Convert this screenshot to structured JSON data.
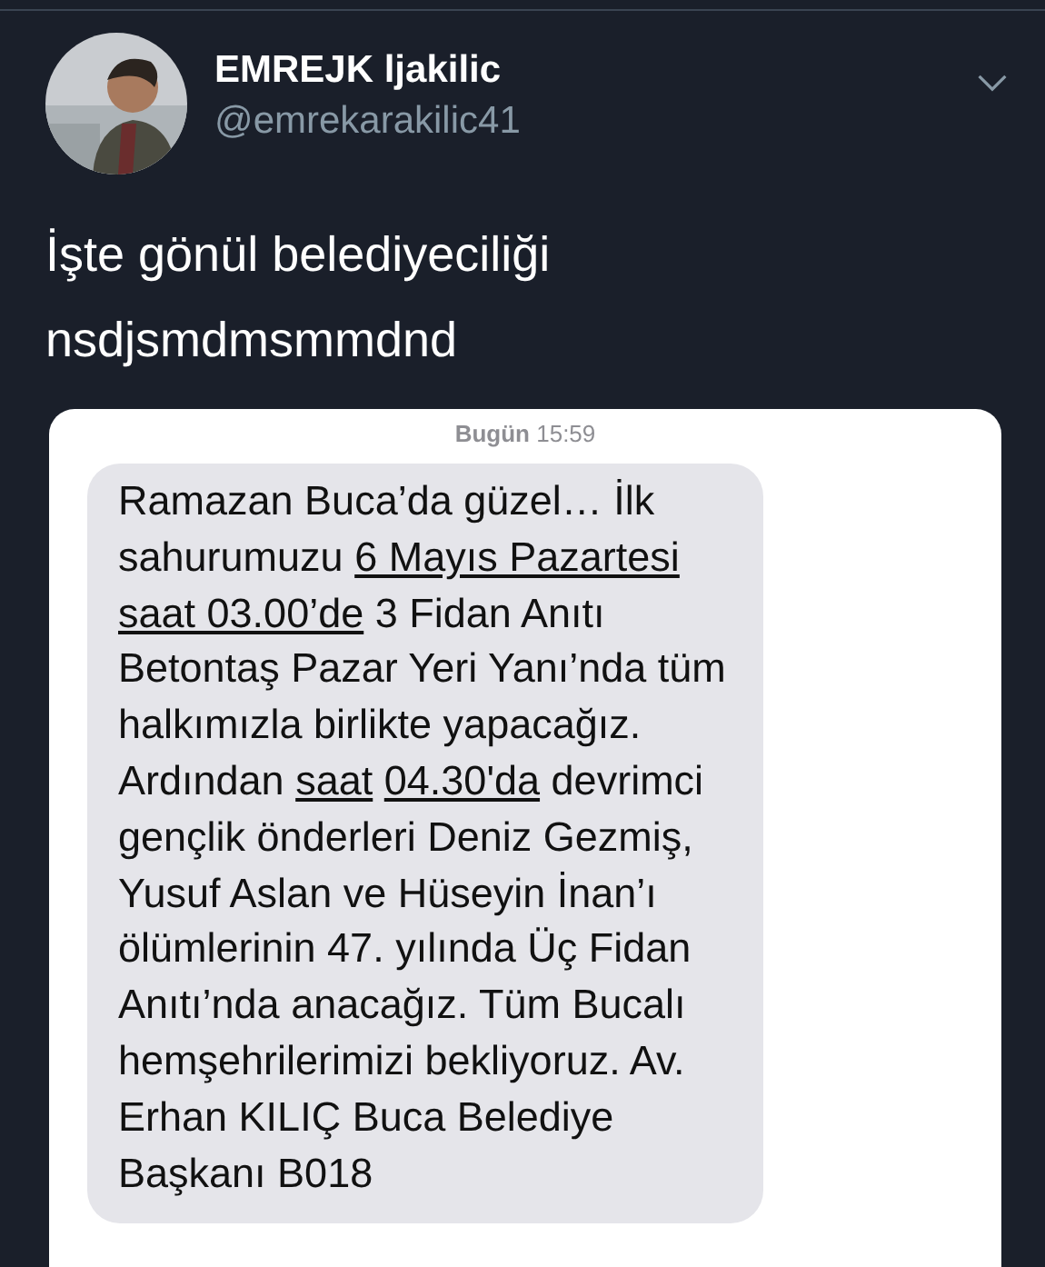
{
  "tweet": {
    "display_name": "EMREJK ljakilic",
    "handle": "@emrekarakilic41",
    "text_lines": [
      "İşte gönül belediyeciliği",
      "nsdjsmdmsmmdnd"
    ]
  },
  "sms": {
    "timestamp_day": "Bugün",
    "timestamp_time": "15:59",
    "message": [
      {
        "text": "Ramazan Buca’da güzel… İlk sahurumuzu",
        "link": false
      },
      {
        "text": "6 Mayıs Pazartesi",
        "link": true
      },
      {
        "text": "saat 03.00’de",
        "link": true
      },
      {
        "text": "3 Fidan Anıtı Betontaş Pazar Yeri Yanı’nda tüm halkımızla birlikte yapacağız. Ardından",
        "link": false
      },
      {
        "text": "saat",
        "link": true
      },
      {
        "text": "04.30'da",
        "link": true
      },
      {
        "text": "devrimci gençlik önderleri Deniz Gezmiş, Yusuf Aslan ve Hüseyin İnan’ı ölümlerinin 47. yılında Üç Fidan Anıtı’nda anacağız. Tüm Bucalı hemşehrilerimizi bekliyoruz. Av. Erhan KILIÇ Buca Belediye Başkanı B018",
        "link": false
      }
    ]
  }
}
